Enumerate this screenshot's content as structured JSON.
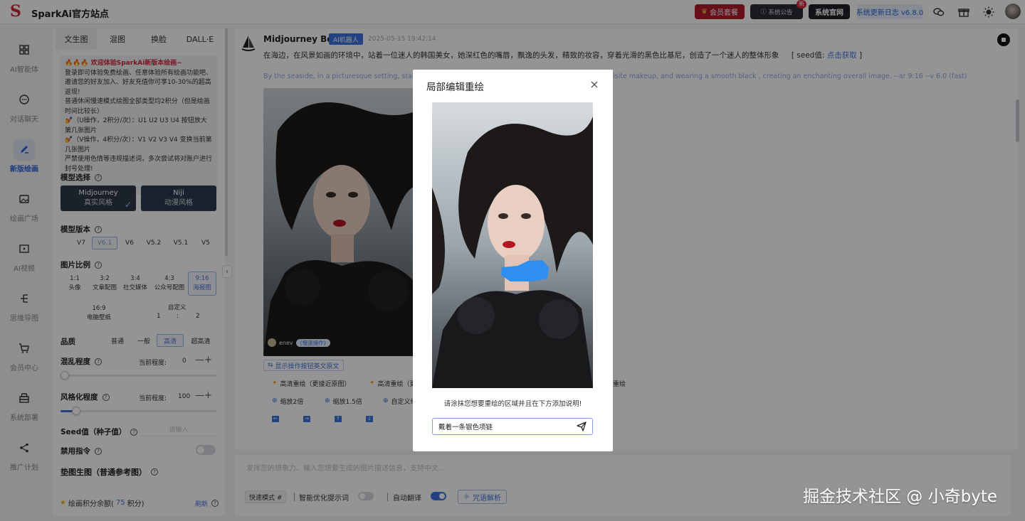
{
  "app": {
    "logo_mark": "S",
    "name": "SparkAi官方站点"
  },
  "topbar": {
    "vip_label": "会员套餐",
    "notice_label": "系统公告",
    "notice_badge": "新",
    "official_label": "系统官网",
    "update_label": "系统更新日志 v6.8.0",
    "icons": [
      "wechat-icon",
      "gift-icon",
      "sun-icon",
      "avatar"
    ]
  },
  "nav": [
    {
      "label": "AI智能体",
      "icon": "grid-icon"
    },
    {
      "label": "对话聊天",
      "icon": "chat-icon"
    },
    {
      "label": "新版绘画",
      "icon": "brush-icon",
      "active": true
    },
    {
      "label": "绘画广场",
      "icon": "image-icon"
    },
    {
      "label": "AI视频",
      "icon": "video-icon"
    },
    {
      "label": "思维导图",
      "icon": "mindmap-icon"
    },
    {
      "label": "会员中心",
      "icon": "cart-icon"
    },
    {
      "label": "系统部署",
      "icon": "deploy-icon"
    },
    {
      "label": "推广计划",
      "icon": "share-icon"
    }
  ],
  "panel": {
    "tabs": [
      "文生图",
      "混图",
      "换脸",
      "DALL·E"
    ],
    "notice_title": "🔥🔥🔥 欢迎体验SparkAi新版本绘画~",
    "notice_lines": [
      "登录即可体验免费绘画、任意体验所有绘画功能吧、邀请您的好友加入、好友充值你可享10-30%的超高返现!",
      "普通休闲慢速模式绘图全部类型均2积分（但是绘画时间比较长）",
      "💅（U操作，2积分/次）：U1 U2 U3 U4 按钮放大第几张图片",
      "💅（V操作，4积分/次）：V1 V2 V3 V4 变换当前第几张图片",
      "严禁使用色情等违规描述词，多次尝试将对账户进行封号处理!"
    ],
    "model_label": "模型选择",
    "models": [
      {
        "name": "Midjourney",
        "sub": "真实风格",
        "selected": true
      },
      {
        "name": "Niji",
        "sub": "动漫风格"
      }
    ],
    "version_label": "模型版本",
    "versions": [
      "V7",
      "V6.1",
      "V6",
      "V5.2",
      "V5.1",
      "V5"
    ],
    "version_selected": "V6.1",
    "ratio_label": "图片比例",
    "ratios": [
      {
        "r": "1:1",
        "d": "头像"
      },
      {
        "r": "3:2",
        "d": "文章配图"
      },
      {
        "r": "3:4",
        "d": "社交媒体"
      },
      {
        "r": "4:3",
        "d": "公众号配图"
      },
      {
        "r": "9:16",
        "d": "海报图",
        "selected": true
      }
    ],
    "ratio_extra": {
      "r": "16:9",
      "d": "电脑壁纸"
    },
    "custom_label": "自定义",
    "custom_w": "1",
    "custom_sep": ":",
    "custom_h": "2",
    "quality_label": "品质",
    "qualities": [
      "普通",
      "一般",
      "高清",
      "超高清"
    ],
    "quality_selected": "高清",
    "chaos_label": "混乱程度",
    "chaos_value": "0",
    "chaos_fraction": 0,
    "style_label": "风格化程度",
    "style_value": "100",
    "style_fraction": 0.1,
    "current_label": "当前程度:",
    "minus": "—",
    "plus": "+",
    "seed_label": "Seed值（种子值）",
    "seed_placeholder": "请输入",
    "ban_label": "禁用指令",
    "pad_label": "垫图生图（普通参考图）",
    "balance_prefix": "绘画积分余额(",
    "balance_value": "75",
    "balance_suffix": "积分)",
    "refresh_label": "刷新"
  },
  "chat": {
    "bot_name": "Midjourney Bot",
    "bot_tag": "AI机器人",
    "time": "2025-05-15 19:42:14",
    "prompt": "在海边，在风景如画的环境中，站着一位迷人的韩国美女，她深红色的嘴唇，飘逸的头发，精致的妆容，穿着光滑的黑色比基尼，创造了一个迷人的整体形象",
    "seed_label": "[ seed值: ",
    "seed_link": "点击获取",
    "seed_close": " ]",
    "en_prompt_left": "By the seaside, in a picturesque setting, stands",
    "en_prompt_right": "isite makeup, and wearing a smooth black , creating an enchanting overall image. --ar 9:16 --v 6.0  (fast)",
    "img_user": "enev",
    "img_tag": "(慢速操作)",
    "show_en": "显示操作按钮英文原文",
    "actions_row1": [
      "高清重绘（更接近原图）",
      "高清重绘（更",
      "重绘"
    ],
    "actions_row2": [
      "缩放2倍",
      "缩放1.5倍",
      "自定义缩"
    ],
    "arrows": [
      "←",
      "→",
      "↑",
      "↓"
    ]
  },
  "input": {
    "placeholder": "发挥您的想象力、输入您想要生成的图片描述信息，支持中文...",
    "quick_mode": "快速模式 #",
    "optimize_label": "智能优化提示词",
    "optimize_on": false,
    "translate_label": "自动翻译",
    "translate_on": true,
    "spell_label": "咒语解析"
  },
  "modal": {
    "title": "局部编辑重绘",
    "close": "×",
    "hint": "请涂抹您想要重绘的区域并且在下方添加说明!",
    "input_value": "戴着一条银色项链",
    "mask_color": "#2f8ff0"
  },
  "watermark": "掘金技术社区 @ 小奇byte",
  "colors": {
    "accent": "#3d72df",
    "brand_red": "#d0263a",
    "dark": "#2d3948"
  }
}
